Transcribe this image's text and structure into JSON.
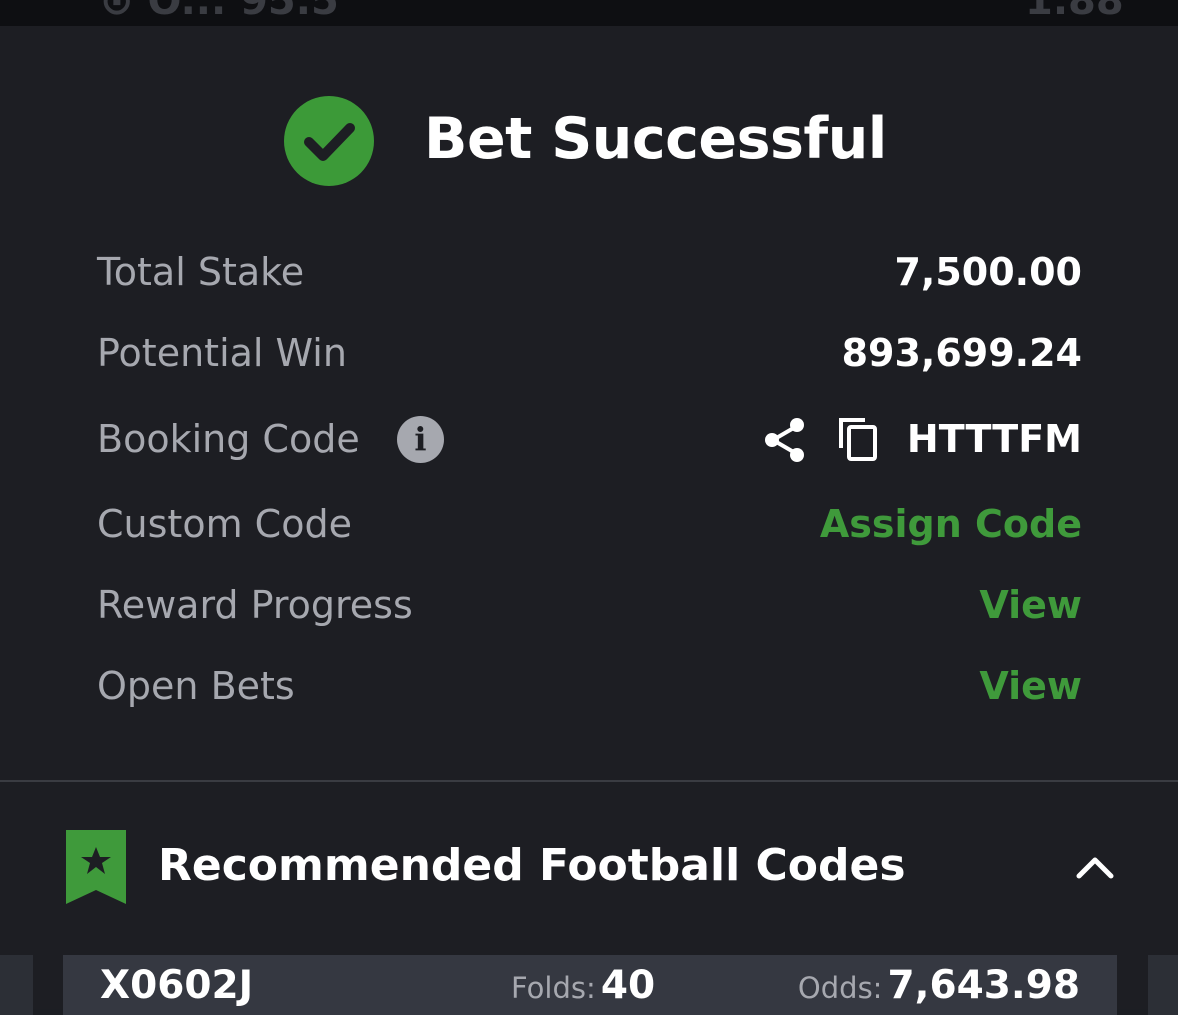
{
  "top_strip": {
    "ghost_left": "⊙ O... 95.5",
    "ghost_right": "1.88"
  },
  "header": {
    "title": "Bet Successful"
  },
  "details": {
    "total_stake": {
      "label": "Total Stake",
      "value": "7,500.00"
    },
    "potential_win": {
      "label": "Potential Win",
      "value": "893,699.24"
    },
    "booking_code": {
      "label": "Booking Code",
      "info": "i",
      "value": "HTTTFM"
    },
    "custom_code": {
      "label": "Custom Code",
      "action": "Assign Code"
    },
    "reward_progress": {
      "label": "Reward Progress",
      "action": "View"
    },
    "open_bets": {
      "label": "Open Bets",
      "action": "View"
    }
  },
  "recommended": {
    "title": "Recommended Football Codes",
    "cards": [
      {
        "code": "X0602J",
        "folds_label": "Folds:",
        "folds": "40",
        "odds_label": "Odds:",
        "odds": "7,643.98"
      }
    ]
  },
  "colors": {
    "accent_green": "#3f9a3b",
    "background": "#1d1e23",
    "label_gray": "#a6a8af"
  }
}
